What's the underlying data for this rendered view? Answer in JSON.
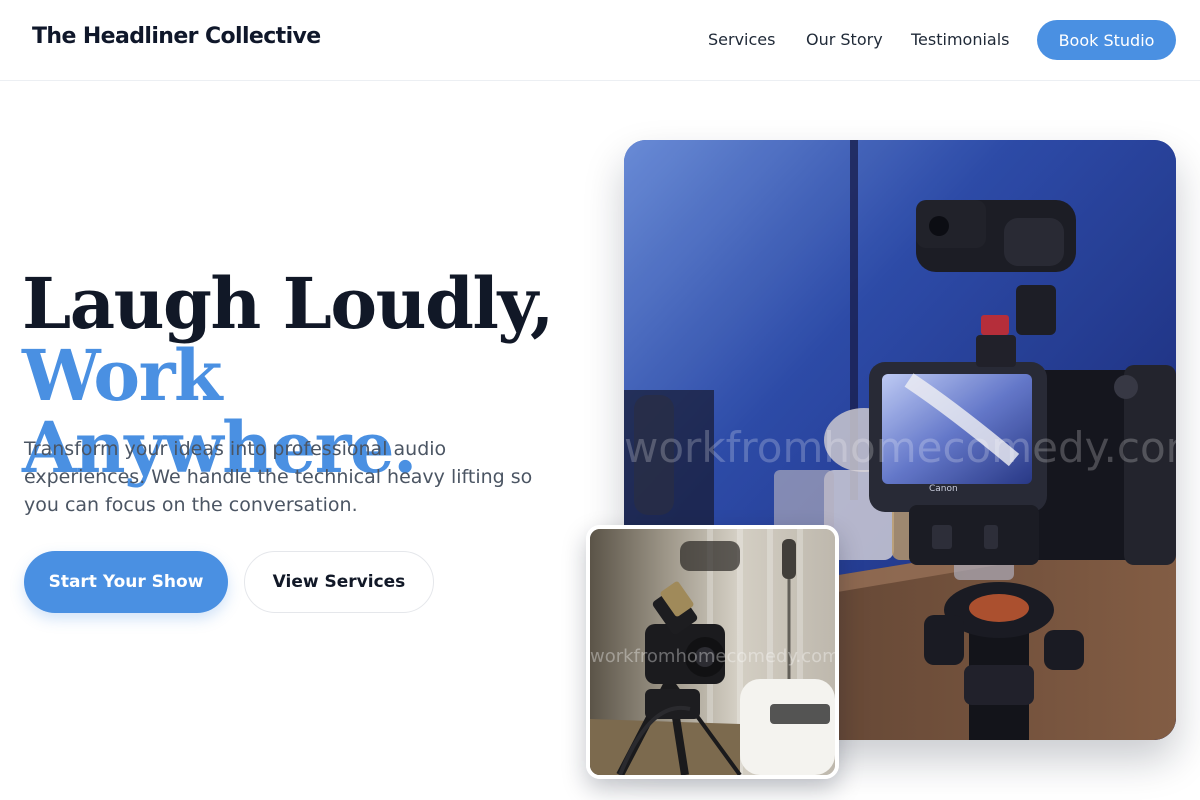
{
  "header": {
    "brand": "The Headliner Collective",
    "nav": [
      {
        "label": "Services"
      },
      {
        "label": "Our Story"
      },
      {
        "label": "Testimonials"
      }
    ],
    "cta_label": "Book Studio"
  },
  "hero": {
    "title_line1": "Laugh Loudly,",
    "title_line2": "Work Anywhere.",
    "subtitle": "Transform your ideas into professional audio experiences. We handle the technical heavy lifting so you can focus on the conversation.",
    "primary_button": "Start Your Show",
    "secondary_button": "View Services"
  },
  "images": {
    "main_watermark": "workfromhomecomedy.com",
    "main_camera_brand": "Canon",
    "inset_watermark": "workfromhomecomedy.com"
  },
  "colors": {
    "accent": "#4a90e2",
    "heading": "#111827",
    "body_text": "#4b5563"
  }
}
